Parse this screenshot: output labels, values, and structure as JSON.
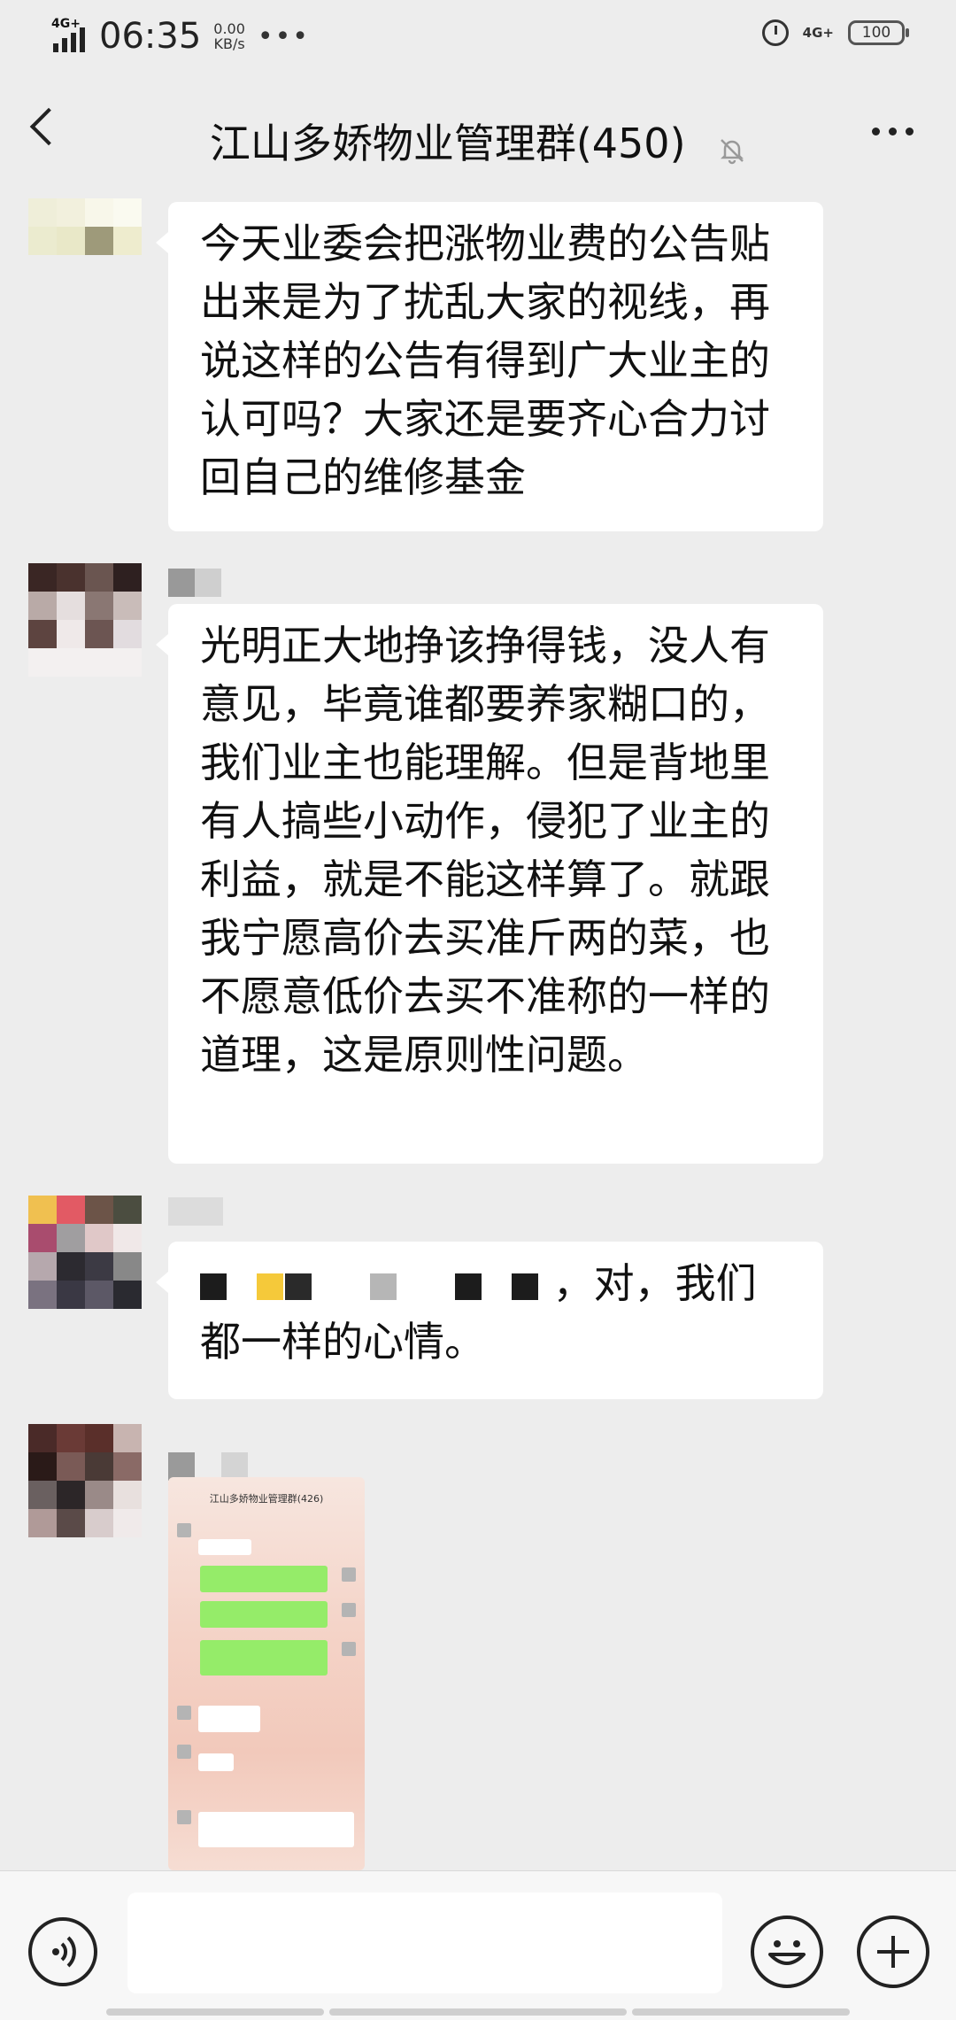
{
  "status_bar": {
    "signal_tag": "4G+",
    "time": "06:35",
    "net_speed_value": "0.00",
    "net_speed_unit": "KB/s",
    "more": "•••",
    "net_type": "4G+",
    "battery": "100"
  },
  "header": {
    "title": "江山多娇物业管理群(450)"
  },
  "messages": [
    {
      "text": "今天业委会把涨物业费的公告贴出来是为了扰乱大家的视线，再说这样的公告有得到广大业主的认可吗？大家还是要齐心合力讨回自己的维修基金"
    },
    {
      "text": "光明正大地挣该挣得钱，没人有意见，毕竟谁都要养家糊口的，我们业主也能理解。但是背地里有人搞些小动作，侵犯了业主的利益，就是不能这样算了。就跟我宁愿高价去买准斤两的菜，也不愿意低价去买不准称的一样的道理，这是原则性问题。"
    },
    {
      "text_suffix": "，对，我们都一样的心情。"
    }
  ],
  "shared_image": {
    "title": "江山多娇物业管理群(426)"
  },
  "colors": {
    "background": "#ededed",
    "bubble": "#ffffff",
    "input_bar": "#f7f7f7"
  },
  "icons": [
    "back-icon",
    "mute-bell-icon",
    "more-icon",
    "voice-icon",
    "emoji-icon",
    "plus-icon"
  ]
}
